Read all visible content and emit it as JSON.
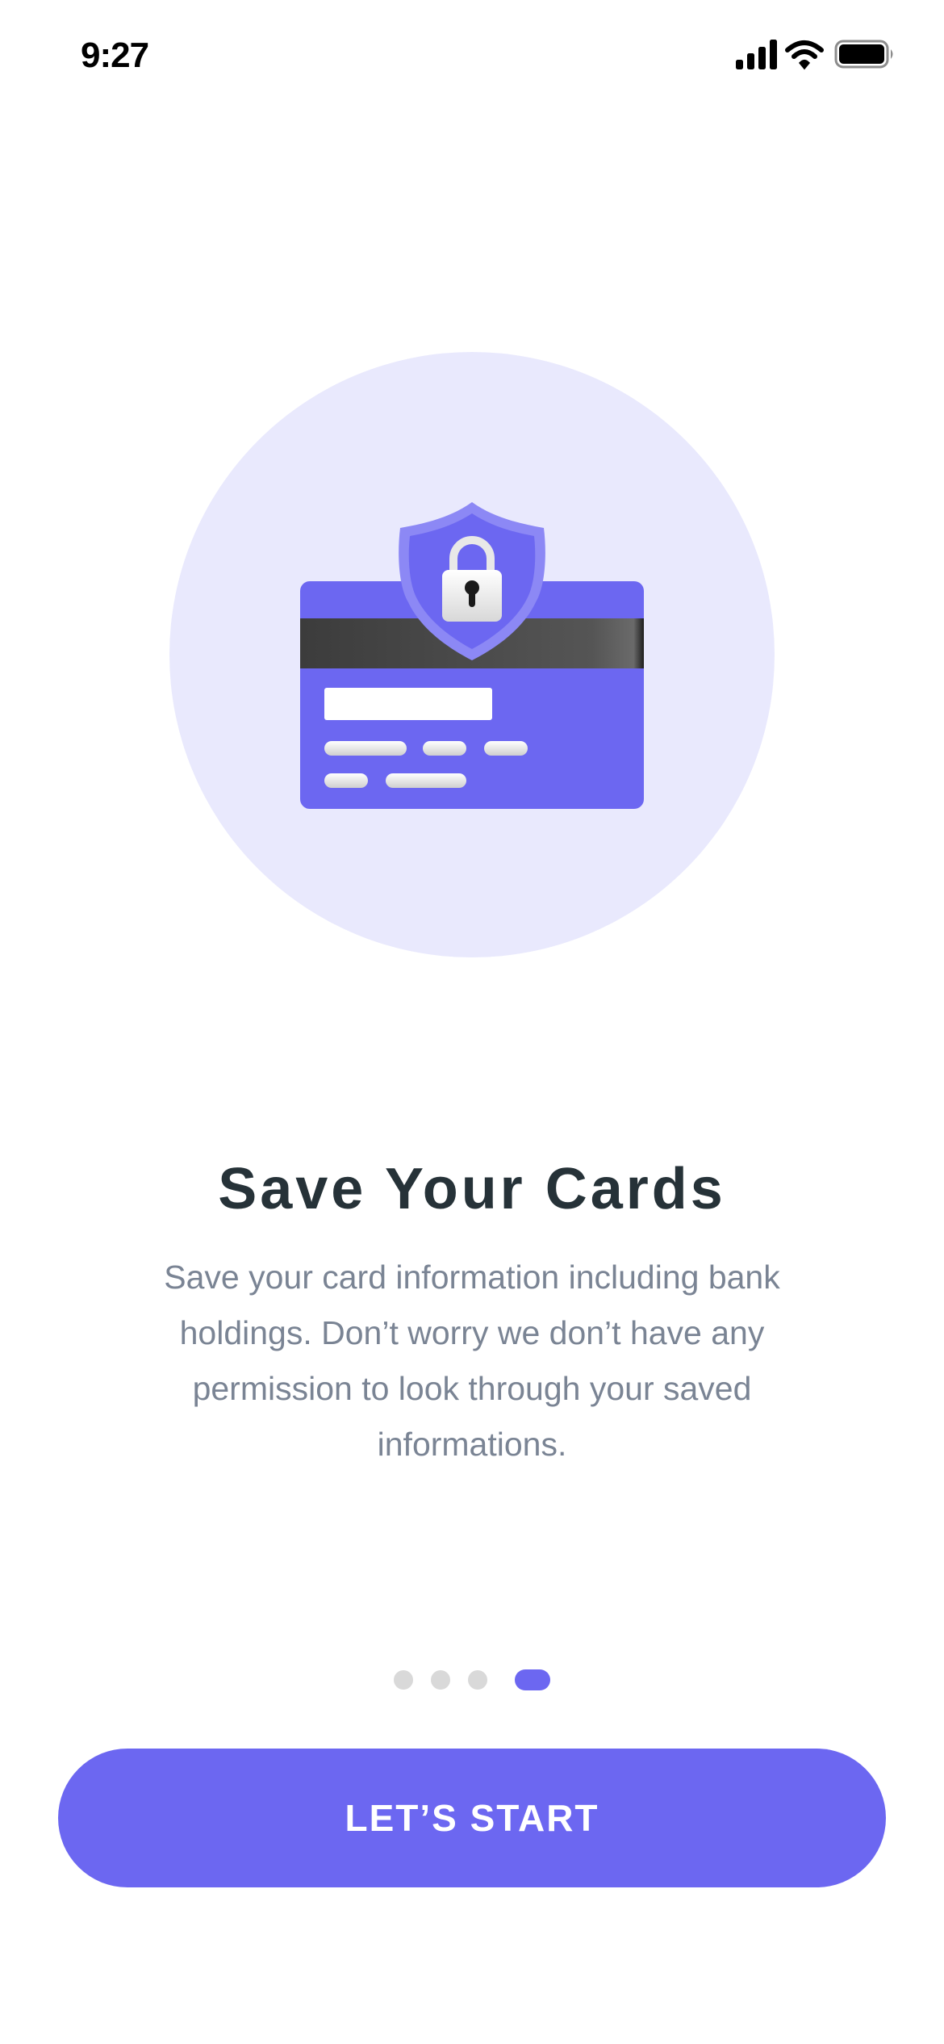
{
  "status_bar": {
    "time": "9:27",
    "icons": [
      "cellular-signal-icon",
      "wifi-icon",
      "battery-icon"
    ]
  },
  "illustration": {
    "icon": "credit-card-shield-lock-icon"
  },
  "onboarding": {
    "title": "Save Your Cards",
    "description": "Save your card information including bank holdings. Don’t worry we don’t have any permission to look through your saved informations."
  },
  "pager": {
    "total": 4,
    "active_index": 3
  },
  "cta": {
    "label": "LET’S START"
  },
  "colors": {
    "accent": "#6c67f1",
    "hero_background": "#e9e9fd",
    "title": "#263238",
    "body_text": "#7a8494",
    "inactive_dot": "#d9d9d9"
  }
}
